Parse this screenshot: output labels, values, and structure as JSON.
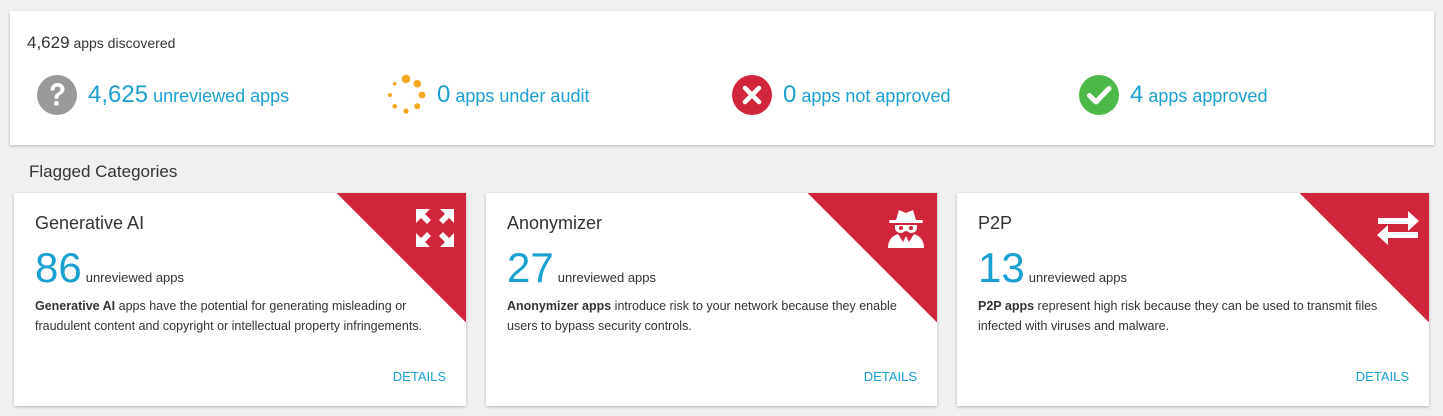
{
  "summary": {
    "discovered_count": "4,629",
    "discovered_label": "apps discovered",
    "stats": [
      {
        "count": "4,625",
        "label": "unreviewed apps",
        "icon": "question-icon",
        "color": "#999999"
      },
      {
        "count": "0",
        "label": "apps under audit",
        "icon": "audit-spinner-icon",
        "color": "#f5a623"
      },
      {
        "count": "0",
        "label": "apps not approved",
        "icon": "x-circle-icon",
        "color": "#d0253b"
      },
      {
        "count": "4",
        "label": "apps approved",
        "icon": "check-circle-icon",
        "color": "#4cb848"
      }
    ]
  },
  "flagged": {
    "title": "Flagged Categories",
    "cards": [
      {
        "name": "Generative AI",
        "count": "86",
        "unit": "unreviewed apps",
        "desc_bold": "Generative AI",
        "desc_text": " apps have the potential for generating misleading or fraudulent content and copyright or intellectual property infringements.",
        "details": "DETAILS",
        "icon": "expand-arrows-icon"
      },
      {
        "name": "Anonymizer",
        "count": "27",
        "unit": "unreviewed apps",
        "desc_bold": "Anonymizer apps",
        "desc_text": " introduce risk to your network because they enable users to bypass security controls.",
        "details": "DETAILS",
        "icon": "spy-icon"
      },
      {
        "name": "P2P",
        "count": "13",
        "unit": "unreviewed apps",
        "desc_bold": "P2P apps",
        "desc_text": " represent high risk because they can be used to transmit files infected with viruses and malware.",
        "details": "DETAILS",
        "icon": "exchange-arrows-icon"
      }
    ]
  },
  "colors": {
    "accent": "#1ba0d2",
    "flag": "#d0253b"
  }
}
